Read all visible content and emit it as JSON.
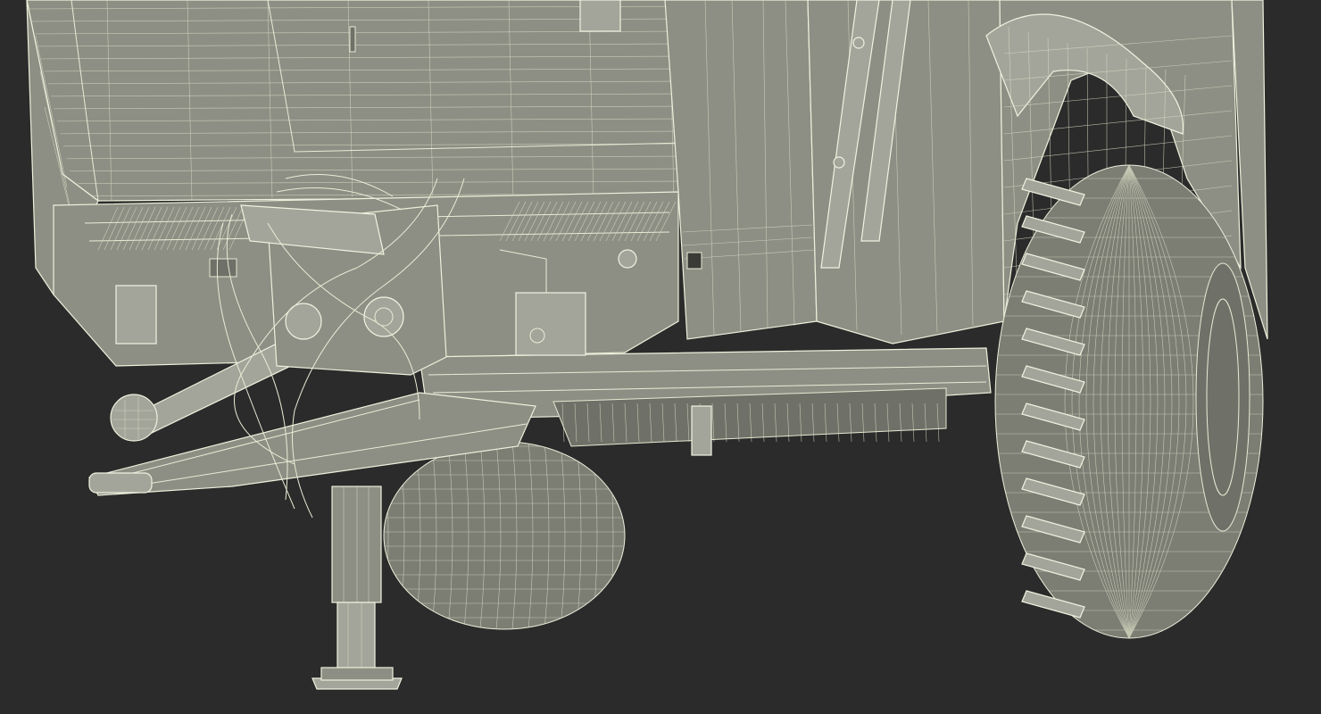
{
  "scene": {
    "background_color": "#2b2b2b",
    "wire_color": "#e9ecd6",
    "surface_color": "#8d8f84"
  }
}
